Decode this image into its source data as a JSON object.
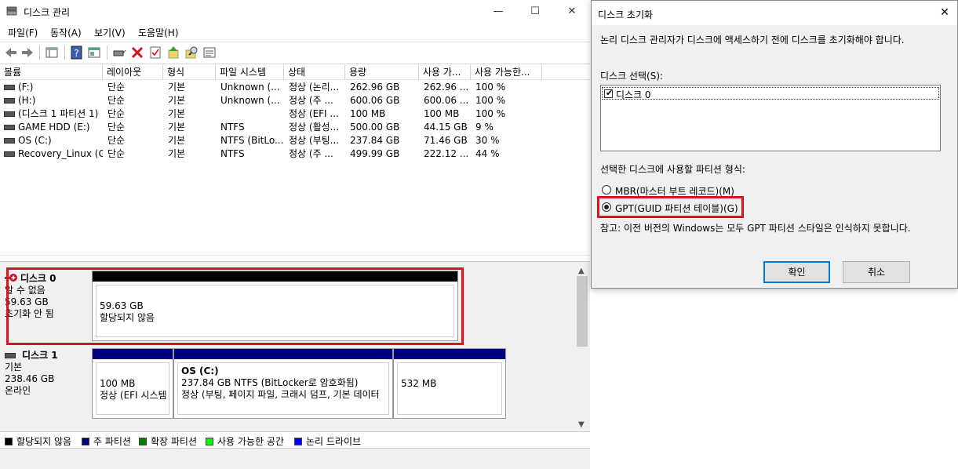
{
  "main_window": {
    "title": "디스크 관리",
    "window_buttons": {
      "minimize": "—",
      "maximize": "☐",
      "close": "✕"
    },
    "menu": [
      "파일(F)",
      "동작(A)",
      "보기(V)",
      "도움말(H)"
    ],
    "toolbar_icons": [
      "back-icon",
      "forward-icon",
      "console-tree-icon",
      "help-icon",
      "properties-icon",
      "connect-icon",
      "delete-icon",
      "check-icon",
      "up-icon",
      "search-icon",
      "details-icon"
    ]
  },
  "volume_list": {
    "columns": [
      "볼륨",
      "레이아웃",
      "형식",
      "파일 시스템",
      "상태",
      "용량",
      "사용 가...",
      "사용 가능한..."
    ],
    "rows": [
      [
        "(F:)",
        "단순",
        "기본",
        "Unknown (...",
        "정상 (논리...",
        "262.96 GB",
        "262.96 ...",
        "100 %"
      ],
      [
        "(H:)",
        "단순",
        "기본",
        "Unknown (...",
        "정상 (주 ...",
        "600.06 GB",
        "600.06 ...",
        "100 %"
      ],
      [
        "(디스크 1 파티션 1)",
        "단순",
        "기본",
        "",
        "정상 (EFI ...",
        "100 MB",
        "100 MB",
        "100 %"
      ],
      [
        "GAME HDD (E:)",
        "단순",
        "기본",
        "NTFS",
        "정상 (활성...",
        "500.00 GB",
        "44.15 GB",
        "9 %"
      ],
      [
        "OS (C:)",
        "단순",
        "기본",
        "NTFS (BitLo...",
        "정상 (부팅...",
        "237.84 GB",
        "71.46 GB",
        "30 %"
      ],
      [
        "Recovery_Linux (G:)",
        "단순",
        "기본",
        "NTFS",
        "정상 (주 ...",
        "499.99 GB",
        "222.12 ...",
        "44 %"
      ]
    ]
  },
  "disks": {
    "disk0": {
      "name": "디스크 0",
      "type": "알 수 없음",
      "size": "59.63 GB",
      "status": "초기화 안 됨",
      "partition": {
        "size": "59.63 GB",
        "status": "할당되지 않음"
      }
    },
    "disk1": {
      "name": "디스크 1",
      "type": "기본",
      "size": "238.46 GB",
      "status": "온라인",
      "partitions": [
        {
          "title": "",
          "size": "100 MB",
          "status": "정상 (EFI 시스템"
        },
        {
          "title": "OS  (C:)",
          "size": "237.84 GB NTFS (BitLocker로 암호화됨)",
          "status": "정상 (부팅, 페이지 파일, 크래시 덤프, 기본 데이터"
        },
        {
          "title": "",
          "size": "532 MB",
          "status": ""
        }
      ]
    }
  },
  "legend": [
    {
      "label": "할당되지 않음",
      "color": "#000000"
    },
    {
      "label": "주 파티션",
      "color": "#00007f"
    },
    {
      "label": "확장 파티션",
      "color": "#007f00"
    },
    {
      "label": "사용 가능한 공간",
      "color": "#00ff00"
    },
    {
      "label": "논리 드라이브",
      "color": "#0000ff"
    }
  ],
  "dialog": {
    "title": "디스크 초기화",
    "close": "✕",
    "intro": "논리 디스크 관리자가 디스크에 액세스하기 전에 디스크를 초기화해야 합니다.",
    "select_label": "디스크 선택(S):",
    "disk_item": "디스크 0",
    "partition_label": "선택한 디스크에 사용할 파티션 형식:",
    "mbr_option": "MBR(마스터 부트 레코드)(M)",
    "gpt_option": "GPT(GUID 파티션 테이블)(G)",
    "note": "참고: 이전 버전의 Windows는 모두 GPT 파티션 스타일은 인식하지 못합니다.",
    "ok": "확인",
    "cancel": "취소",
    "selected_option": "GPT"
  },
  "colors": {
    "highlight": "#e0101c",
    "primary_partition": "#00007f",
    "unallocated": "#000000",
    "focus_border": "#0078d7"
  }
}
